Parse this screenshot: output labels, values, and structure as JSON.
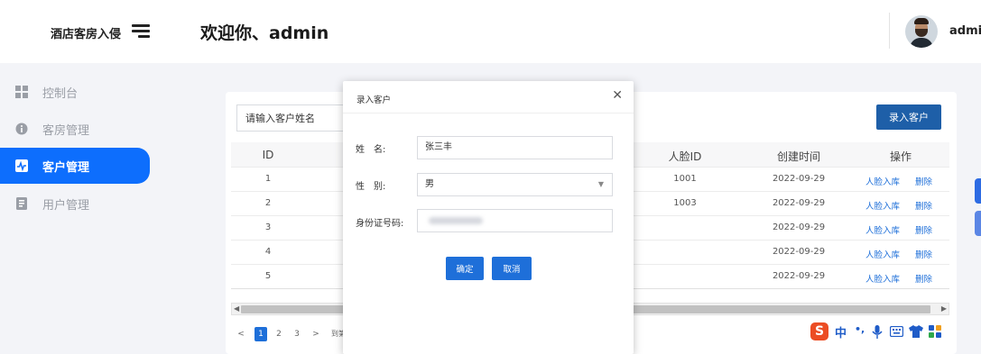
{
  "header": {
    "brand": "酒店客房入侵",
    "welcome": "欢迎你、admin",
    "user_name": "admi"
  },
  "sidebar": {
    "items": [
      {
        "label": "控制台",
        "icon": "dashboard-icon"
      },
      {
        "label": "客房管理",
        "icon": "info-icon"
      },
      {
        "label": "客户管理",
        "icon": "activity-icon",
        "active": true
      },
      {
        "label": "用户管理",
        "icon": "document-icon"
      }
    ]
  },
  "toolbar": {
    "search_placeholder": "请输入客户姓名",
    "add_label": "录入客户"
  },
  "table": {
    "headers": {
      "id": "ID",
      "face_id": "人脸ID",
      "created": "创建时间",
      "ops": "操作"
    },
    "rows": [
      {
        "id": "1",
        "face_id": "1001",
        "created": "2022-09-29"
      },
      {
        "id": "2",
        "face_id": "1003",
        "created": "2022-09-29"
      },
      {
        "id": "3",
        "face_id": "",
        "created": "2022-09-29"
      },
      {
        "id": "4",
        "face_id": "",
        "created": "2022-09-29"
      },
      {
        "id": "5",
        "face_id": "",
        "created": "2022-09-29"
      }
    ],
    "action_face": "人脸入库",
    "action_delete": "删除"
  },
  "pager": {
    "prev": "<",
    "pages": [
      "1",
      "2",
      "3"
    ],
    "next": ">",
    "goto": "到第"
  },
  "ime": {
    "logo": "S",
    "zh": "中"
  },
  "modal": {
    "title": "录入客户",
    "name_label": "姓　名:",
    "name_value": "张三丰",
    "gender_label": "性　别:",
    "gender_value": "男",
    "id_label": "身份证号码:",
    "confirm": "确定",
    "cancel": "取消"
  },
  "colors": {
    "accent": "#0d6efd",
    "button": "#1e5fa8",
    "link": "#1e6fd9"
  }
}
